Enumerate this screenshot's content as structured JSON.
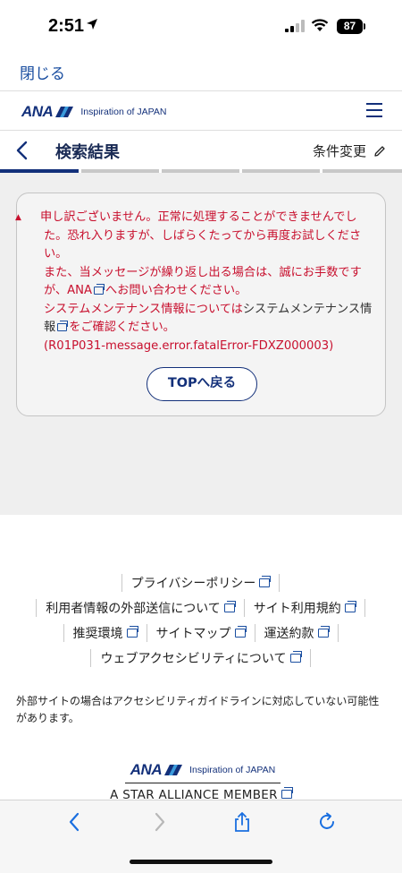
{
  "status_bar": {
    "time": "2:51",
    "battery": "87"
  },
  "close_bar": {
    "label": "閉じる"
  },
  "header": {
    "logo_text": "ANA",
    "tagline": "Inspiration of JAPAN"
  },
  "title_bar": {
    "title": "検索結果",
    "change_label": "条件変更"
  },
  "error": {
    "line1": "申し訳ございません。正常に処理することができませんでした。恐れ入りますが、しばらくたってから再度お試しください。",
    "line2a": "また、当メッセージが繰り返し出る場合は、誠にお手数ですが、ANA",
    "line2b": "へお問い合わせください。",
    "line3a": "システムメンテナンス情報については",
    "line3b": "システムメンテナンス情報",
    "line3c": "をご確認ください。",
    "code": "(R01P031-message.error.fatalError-FDXZ000003)"
  },
  "top_button": {
    "label": "TOPへ戻る"
  },
  "footer": {
    "links": {
      "privacy": "プライバシーポリシー",
      "external_transmission": "利用者情報の外部送信について",
      "terms": "サイト利用規約",
      "environment": "推奨環境",
      "sitemap": "サイトマップ",
      "carriage": "運送約款",
      "accessibility": "ウェブアクセシビリティについて"
    },
    "note": "外部サイトの場合はアクセシビリティガイドラインに対応していない可能性があります。",
    "logo_text": "ANA",
    "tagline": "Inspiration of JAPAN",
    "star_alliance": "A STAR ALLIANCE MEMBER"
  }
}
